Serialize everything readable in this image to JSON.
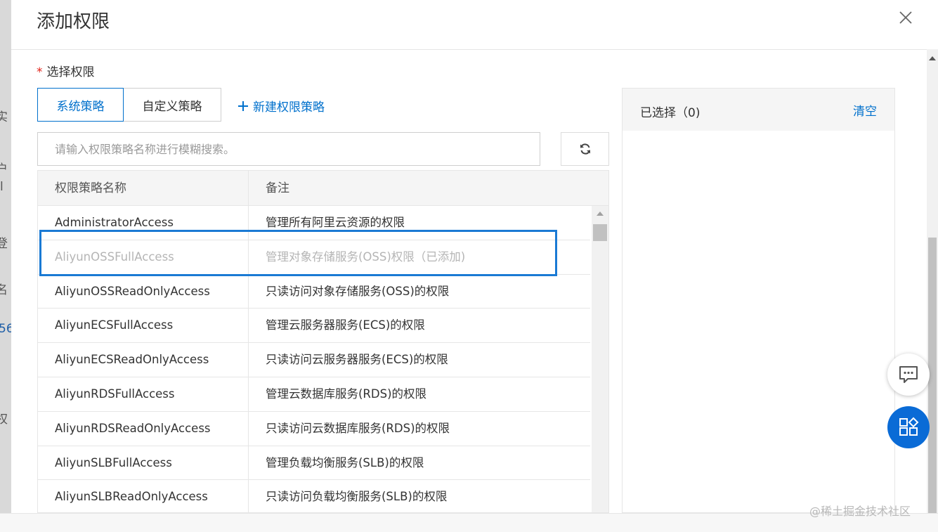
{
  "background": {
    "fragments": [
      "实",
      "户",
      "l",
      "登",
      "名",
      "56",
      "权"
    ]
  },
  "dialog": {
    "title": "添加权限",
    "close_icon": "close-icon"
  },
  "form": {
    "required_mark": "*",
    "select_label": "选择权限"
  },
  "tabs": [
    {
      "label": "系统策略",
      "active": true
    },
    {
      "label": "自定义策略",
      "active": false
    }
  ],
  "new_policy": {
    "icon": "plus-icon",
    "label": "新建权限策略"
  },
  "search": {
    "value": "",
    "placeholder": "请输入权限策略名称进行模糊搜索。"
  },
  "refresh_icon": "refresh-icon",
  "table": {
    "headers": [
      "权限策略名称",
      "备注"
    ],
    "rows": [
      {
        "name": "AdministratorAccess",
        "note": "管理所有阿里云资源的权限",
        "disabled": false
      },
      {
        "name": "AliyunOSSFullAccess",
        "note": "管理对象存储服务(OSS)权限（已添加)",
        "disabled": true
      },
      {
        "name": "AliyunOSSReadOnlyAccess",
        "note": "只读访问对象存储服务(OSS)的权限",
        "disabled": false
      },
      {
        "name": "AliyunECSFullAccess",
        "note": "管理云服务器服务(ECS)的权限",
        "disabled": false
      },
      {
        "name": "AliyunECSReadOnlyAccess",
        "note": "只读访问云服务器服务(ECS)的权限",
        "disabled": false
      },
      {
        "name": "AliyunRDSFullAccess",
        "note": "管理云数据库服务(RDS)的权限",
        "disabled": false
      },
      {
        "name": "AliyunRDSReadOnlyAccess",
        "note": "只读访问云数据库服务(RDS)的权限",
        "disabled": false
      },
      {
        "name": "AliyunSLBFullAccess",
        "note": "管理负载均衡服务(SLB)的权限",
        "disabled": false
      },
      {
        "name": "AliyunSLBReadOnlyAccess",
        "note": "只读访问负载均衡服务(SLB)的权限",
        "disabled": false
      }
    ]
  },
  "selected": {
    "title": "已选择（0)",
    "clear_label": "清空"
  },
  "floating": {
    "chat_icon": "chat-icon",
    "apps_icon": "apps-icon"
  },
  "watermark": "@稀土掘金技术社区",
  "colors": {
    "accent": "#0070cc",
    "highlight": "#1a7ad4",
    "required": "#e2231a",
    "float_button": "#0a6bd6"
  }
}
